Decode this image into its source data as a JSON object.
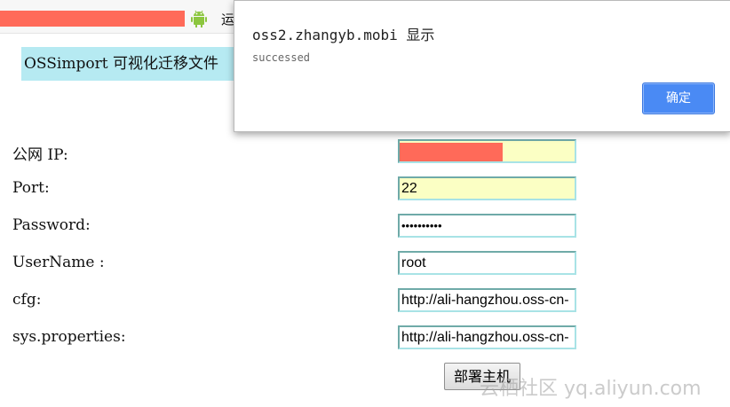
{
  "topbar": {
    "icon": "android-icon",
    "text": "运"
  },
  "page": {
    "title": "OSSimport 可视化迁移文件"
  },
  "form": {
    "fields": [
      {
        "label": "公网 IP:",
        "value": "",
        "redacted": true
      },
      {
        "label": "Port:",
        "value": "22"
      },
      {
        "label": "Password:",
        "value": "••••••••••"
      },
      {
        "label": "UserName :",
        "value": "root"
      },
      {
        "label": "cfg:",
        "value": "http://ali-hangzhou.oss-cn-"
      },
      {
        "label": "sys.properties:",
        "value": "http://ali-hangzhou.oss-cn-"
      }
    ],
    "deploy_label": "部署主机"
  },
  "dialog": {
    "title": "oss2.zhangyb.mobi 显示",
    "message": "successed",
    "ok_label": "确定"
  },
  "watermark": "云栖社区 yq.aliyun.com",
  "colors": {
    "redaction": "#ff6a59",
    "title_bg": "#b6eaf2",
    "field_highlight": "#fbffc4",
    "ok_button": "#4a8af4"
  }
}
